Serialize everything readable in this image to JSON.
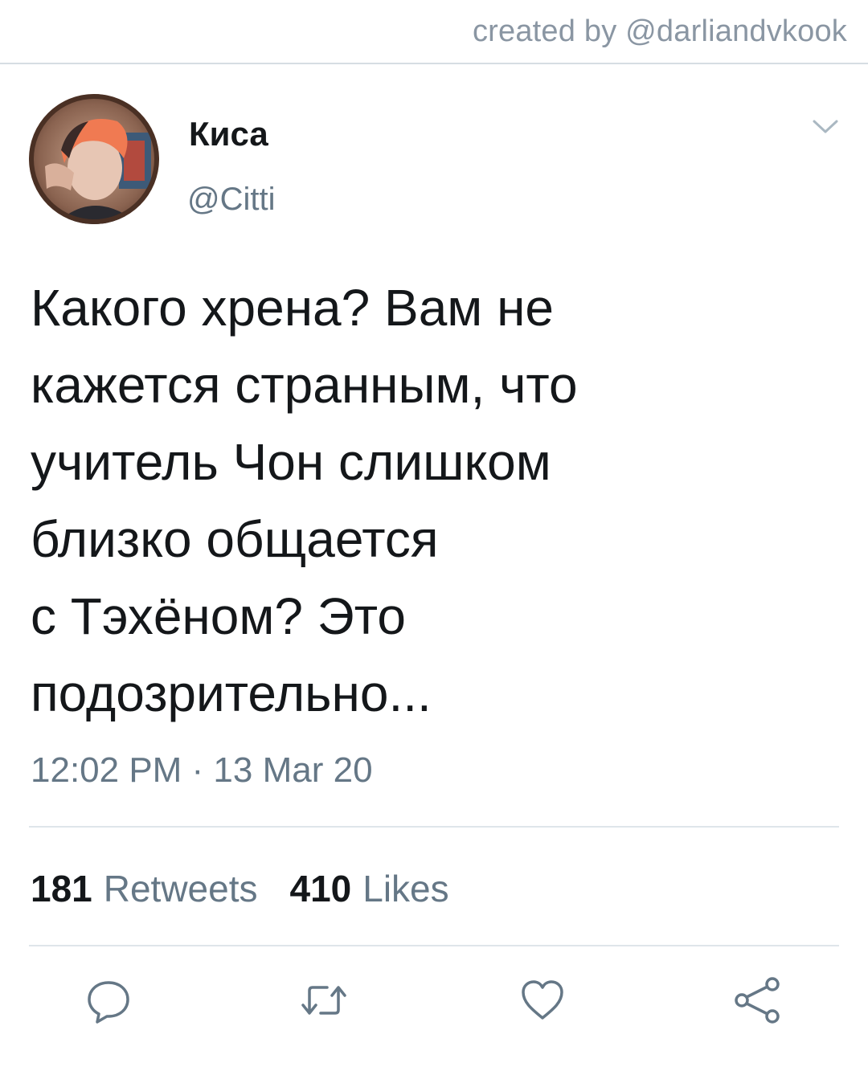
{
  "watermark": "created by @darliandvkook",
  "tweet": {
    "display_name": "Киса",
    "handle": "@Citti",
    "text_lines": [
      "Какого хрена? Вам не",
      "кажется странным, что",
      "учитель Чон слишком",
      "близко общается",
      "с Тэхёном? Это",
      "подозрительно..."
    ],
    "timestamp": "12:02 PM · 13 Mar 20"
  },
  "stats": {
    "retweets_count": "181",
    "retweets_label": "Retweets",
    "likes_count": "410",
    "likes_label": "Likes"
  },
  "actions": {
    "icons": [
      "reply-icon",
      "retweet-icon",
      "like-icon",
      "share-icon"
    ]
  },
  "colors": {
    "text_primary": "#14171a",
    "text_secondary": "#657786",
    "divider": "#dfe5ea"
  }
}
